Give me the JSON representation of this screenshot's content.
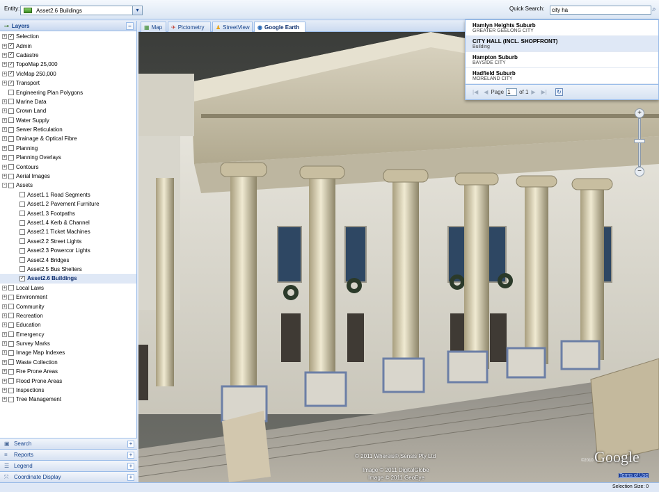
{
  "topbar": {
    "entity_label": "Entity:",
    "entity_value": "Asset2.6 Buildings",
    "quick_search_label": "Quick Search:",
    "quick_search_value": "city ha"
  },
  "layers_panel": {
    "title": "Layers",
    "items": [
      {
        "label": "Selection",
        "checked": true,
        "expand": "+"
      },
      {
        "label": "Admin",
        "checked": true,
        "expand": "+"
      },
      {
        "label": "Cadastre",
        "checked": true,
        "expand": "+"
      },
      {
        "label": "TopoMap 25,000",
        "checked": true,
        "expand": "+"
      },
      {
        "label": "VicMap 250,000",
        "checked": true,
        "expand": "+"
      },
      {
        "label": "Transport",
        "checked": true,
        "expand": "+"
      },
      {
        "label": "Engineering Plan Polygons",
        "checked": false,
        "expand": ""
      },
      {
        "label": "Marine Data",
        "checked": false,
        "expand": "+"
      },
      {
        "label": "Crown Land",
        "checked": false,
        "expand": "+"
      },
      {
        "label": "Water Supply",
        "checked": false,
        "expand": "+"
      },
      {
        "label": "Sewer Reticulation",
        "checked": false,
        "expand": "+"
      },
      {
        "label": "Drainage & Optical Fibre",
        "checked": false,
        "expand": "+"
      },
      {
        "label": "Planning",
        "checked": false,
        "expand": "+"
      },
      {
        "label": "Planning Overlays",
        "checked": false,
        "expand": "+"
      },
      {
        "label": "Contours",
        "checked": false,
        "expand": "+"
      },
      {
        "label": "Aerial Images",
        "checked": false,
        "expand": "+"
      },
      {
        "label": "Assets",
        "checked": false,
        "expand": "-"
      }
    ],
    "asset_children": [
      {
        "label": "Asset1.1 Road Segments",
        "checked": false
      },
      {
        "label": "Asset1.2 Pavement Furniture",
        "checked": false
      },
      {
        "label": "Asset1.3 Footpaths",
        "checked": false
      },
      {
        "label": "Asset1.4 Kerb & Channel",
        "checked": false
      },
      {
        "label": "Asset2.1 Ticket Machines",
        "checked": false
      },
      {
        "label": "Asset2.2 Street Lights",
        "checked": false
      },
      {
        "label": "Asset2.3 Powercor Lights",
        "checked": false
      },
      {
        "label": "Asset2.4 Bridges",
        "checked": false
      },
      {
        "label": "Asset2.5 Bus Shelters",
        "checked": false
      },
      {
        "label": "Asset2.6 Buildings",
        "checked": true,
        "selected": true
      }
    ],
    "more_items": [
      {
        "label": "Local Laws",
        "checked": false
      },
      {
        "label": "Environment",
        "checked": false
      },
      {
        "label": "Community",
        "checked": false
      },
      {
        "label": "Recreation",
        "checked": false
      },
      {
        "label": "Education",
        "checked": false
      },
      {
        "label": "Emergency",
        "checked": false
      },
      {
        "label": "Survey Marks",
        "checked": false
      },
      {
        "label": "Image Map Indexes",
        "checked": false
      },
      {
        "label": "Waste Collection",
        "checked": false
      },
      {
        "label": "Fire Prone Areas",
        "checked": false
      },
      {
        "label": "Flood Prone Areas",
        "checked": false
      },
      {
        "label": "Inspections",
        "checked": false
      },
      {
        "label": "Tree Management",
        "checked": false
      }
    ]
  },
  "accordion": {
    "search": "Search",
    "reports": "Reports",
    "legend": "Legend",
    "coordinate_display": "Coordinate Display"
  },
  "tabs": {
    "map": "Map",
    "pictometry": "Pictometry",
    "streetview": "StreetView",
    "google_earth": "Google Earth",
    "active": "Google Earth"
  },
  "quick_search_results": [
    {
      "title": "Hamlyn Heights Suburb",
      "subtitle": "GREATER GEELONG CITY"
    },
    {
      "title": "CITY HALL (INCL. SHOPFRONT)",
      "subtitle": "Building"
    },
    {
      "title": "Hampton Suburb",
      "subtitle": "BAYSIDE CITY"
    },
    {
      "title": "Hadfield Suburb",
      "subtitle": "MORELAND CITY"
    }
  ],
  "paging": {
    "page_label": "Page",
    "page_value": "1",
    "of_label": "of 1"
  },
  "map_overlay": {
    "copyright_1": "© 2011 Whereis®,Sensis Pty Ltd",
    "copyright_2": "Image © 2011 DigitalGlobe",
    "copyright_3": "Image © 2011 GeoEye",
    "google_year": "©2010",
    "google_logo": "Google",
    "terms": "Terms of Use"
  },
  "status": {
    "text": "Selection Size: 0"
  },
  "colors": {
    "panel_bg": "#dfe8f6",
    "border": "#99bbe8",
    "header_text": "#15428b"
  }
}
